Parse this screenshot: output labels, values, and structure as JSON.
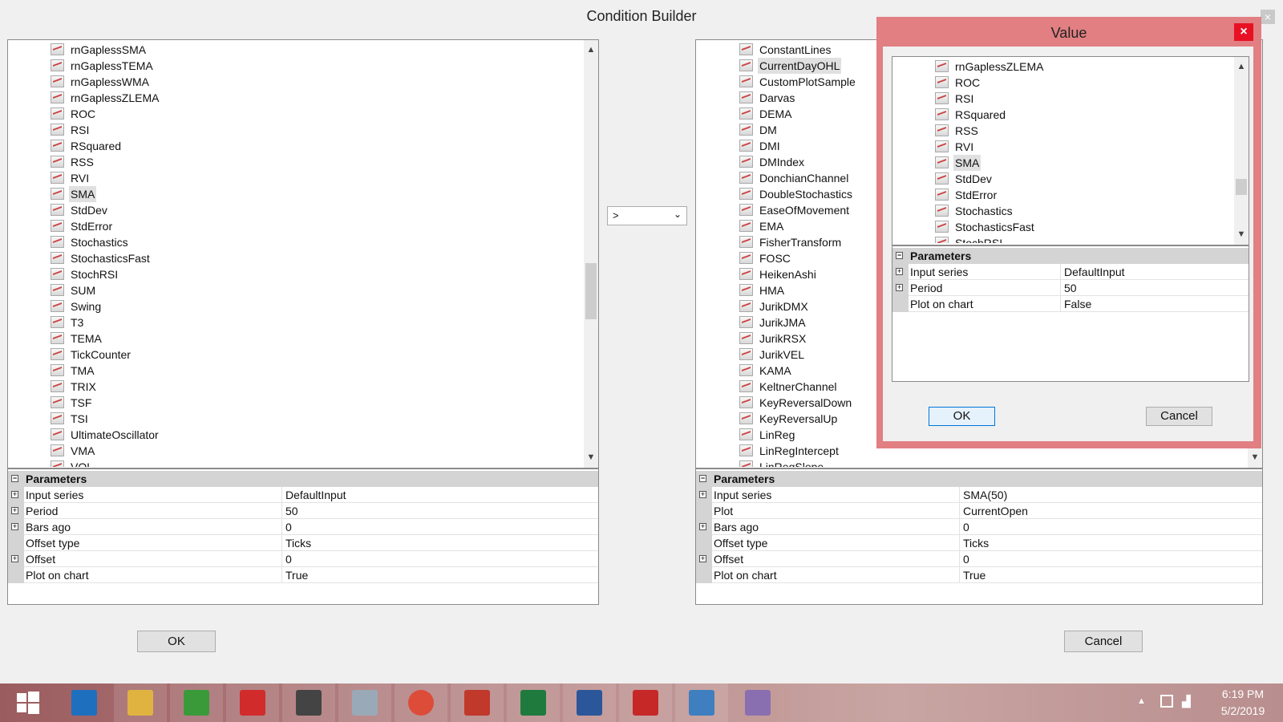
{
  "window": {
    "title": "Condition Builder",
    "close_glyph": "×"
  },
  "left_tree": {
    "items": [
      "rnGaplessSMA",
      "rnGaplessTEMA",
      "rnGaplessWMA",
      "rnGaplessZLEMA",
      "ROC",
      "RSI",
      "RSquared",
      "RSS",
      "RVI",
      "SMA",
      "StdDev",
      "StdError",
      "Stochastics",
      "StochasticsFast",
      "StochRSI",
      "SUM",
      "Swing",
      "T3",
      "TEMA",
      "TickCounter",
      "TMA",
      "TRIX",
      "TSF",
      "TSI",
      "UltimateOscillator",
      "VMA",
      "VOL"
    ],
    "selected": "SMA"
  },
  "left_params": {
    "header": "Parameters",
    "rows": [
      {
        "name": "Input series",
        "value": "DefaultInput",
        "expand": true
      },
      {
        "name": "Period",
        "value": "50",
        "expand": true
      },
      {
        "name": "Bars ago",
        "value": "0",
        "expand": true
      },
      {
        "name": "Offset type",
        "value": "Ticks",
        "expand": false
      },
      {
        "name": "Offset",
        "value": "0",
        "expand": true
      },
      {
        "name": "Plot on chart",
        "value": "True",
        "expand": false
      }
    ]
  },
  "operator": {
    "value": ">"
  },
  "right_tree": {
    "items": [
      "ConstantLines",
      "CurrentDayOHL",
      "CustomPlotSample",
      "Darvas",
      "DEMA",
      "DM",
      "DMI",
      "DMIndex",
      "DonchianChannel",
      "DoubleStochastics",
      "EaseOfMovement",
      "EMA",
      "FisherTransform",
      "FOSC",
      "HeikenAshi",
      "HMA",
      "JurikDMX",
      "JurikJMA",
      "JurikRSX",
      "JurikVEL",
      "KAMA",
      "KeltnerChannel",
      "KeyReversalDown",
      "KeyReversalUp",
      "LinReg",
      "LinRegIntercept",
      "LinRegSlope"
    ],
    "selected": "CurrentDayOHL"
  },
  "right_params": {
    "header": "Parameters",
    "rows": [
      {
        "name": "Input series",
        "value": "SMA(50)",
        "expand": true
      },
      {
        "name": "Plot",
        "value": "CurrentOpen",
        "expand": false
      },
      {
        "name": "Bars ago",
        "value": "0",
        "expand": true
      },
      {
        "name": "Offset type",
        "value": "Ticks",
        "expand": false
      },
      {
        "name": "Offset",
        "value": "0",
        "expand": true
      },
      {
        "name": "Plot on chart",
        "value": "True",
        "expand": false
      }
    ]
  },
  "buttons": {
    "ok": "OK",
    "cancel": "Cancel"
  },
  "value_dialog": {
    "title": "Value",
    "close_glyph": "×",
    "tree_items": [
      "rnGaplessZLEMA",
      "ROC",
      "RSI",
      "RSquared",
      "RSS",
      "RVI",
      "SMA",
      "StdDev",
      "StdError",
      "Stochastics",
      "StochasticsFast",
      "StochRSI"
    ],
    "selected": "SMA",
    "params_header": "Parameters",
    "params": [
      {
        "name": "Input series",
        "value": "DefaultInput",
        "expand": true
      },
      {
        "name": "Period",
        "value": "50",
        "expand": true
      },
      {
        "name": "Plot on chart",
        "value": "False",
        "expand": false
      }
    ],
    "ok": "OK",
    "cancel": "Cancel"
  },
  "taskbar": {
    "time": "6:19 PM",
    "date": "5/2/2019",
    "apps": [
      "start-icon",
      "internet-explorer-icon",
      "file-explorer-icon",
      "store-icon",
      "app-red-icon",
      "app-tool-icon",
      "calculator-icon",
      "chrome-icon",
      "ninjatrader-icon",
      "excel-icon",
      "word-icon",
      "acrobat-icon",
      "photos-icon",
      "paint-icon"
    ],
    "colors": {
      "taskbar": "#b98a8a",
      "dialog_frame": "#e17f82",
      "close_red": "#e81123"
    }
  }
}
